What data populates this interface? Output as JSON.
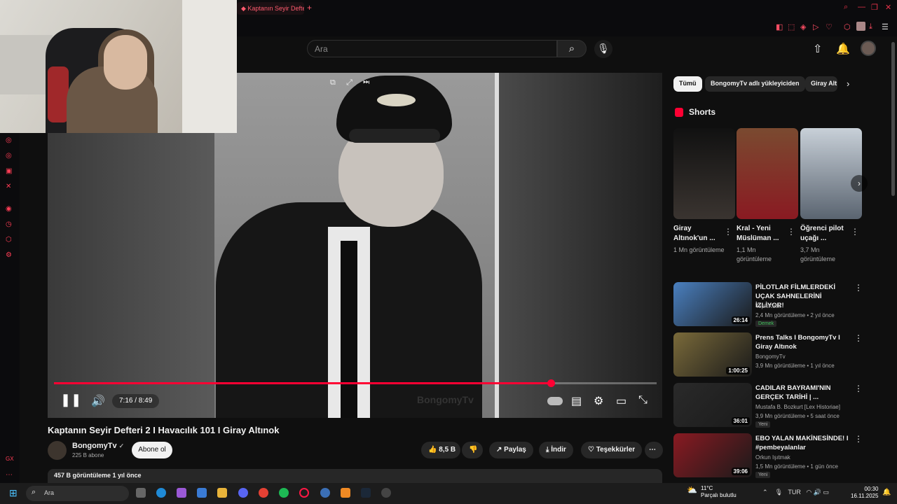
{
  "browser": {
    "tab_title": "Kaptanın Seyir Defteri",
    "new_tab": "+"
  },
  "header": {
    "search_placeholder": "Ara",
    "search_icon": "search-icon",
    "mic_icon": "mic-icon"
  },
  "video": {
    "time": "7:16 / 8:49",
    "progress": 0.824,
    "watermark": "BongomyTv",
    "title": "Kaptanın Seyir Defteri 2 I Havacılık 101 I Giray Altınok"
  },
  "channel": {
    "name": "BongomyTv",
    "subs": "225 B abone",
    "verified": "✓",
    "subscribe": "Abone ol"
  },
  "actions": {
    "likes": "8,5 B",
    "share": "Paylaş",
    "download": "İndir",
    "thanks": "Teşekkürler",
    "more": "⋯"
  },
  "description": {
    "stats": "457 B görüntüleme  1 yıl önce"
  },
  "chips": [
    "Tümü",
    "BongomyTv adlı yükleyiciden",
    "Giray Alt"
  ],
  "shorts": {
    "title": "Shorts",
    "items": [
      {
        "title": "Giray Altınok'un ...",
        "views": "1 Mn görüntüleme"
      },
      {
        "title": "Kral - Yeni Müslüman ...",
        "views": "1,1 Mn görüntüleme"
      },
      {
        "title": "Öğrenci pilot uçağı ...",
        "views": "3,7 Mn görüntüleme"
      }
    ]
  },
  "recommendations": [
    {
      "title": "PİLOTLAR FİLMLERDEKİ UÇAK SAHNELERİNİ İZLİYOR!",
      "channel": "TepkiKolik",
      "meta": "2,4 Mn görüntüleme • 2 yıl önce",
      "badge": "Demek",
      "duration": "26:14",
      "color": "#4a80c0"
    },
    {
      "title": "Prens Talks I BongomyTv I Giray Altınok",
      "channel": "BongomyTv",
      "meta": "3,9 Mn görüntüleme • 1 yıl önce",
      "badge": "",
      "duration": "1:00:25",
      "color": "#7a6a3a"
    },
    {
      "title": "CADILAR BAYRAMI'NIN GERÇEK TARİHİ | ...",
      "channel": "Mustafa B. Bozkurt [Lex Historiae]",
      "meta": "3,9 Mn görüntüleme • 5 saat önce",
      "badge": "Yeni",
      "duration": "36:01",
      "color": "#2a2a2a"
    },
    {
      "title": "EBO YALAN MAKİNESİNDE! I #pembeyalanlar",
      "channel": "Orkun Işıtmak",
      "meta": "1,5 Mn görüntüleme • 1 gün önce",
      "badge": "Yeni",
      "duration": "39:06",
      "color": "#8a1a22"
    }
  ],
  "taskbar": {
    "search": "Ara",
    "weather_temp": "11°C",
    "weather_desc": "Parçalı bulutlu",
    "lang": "TUR",
    "time": "00:30",
    "date": "16.11.2025"
  }
}
